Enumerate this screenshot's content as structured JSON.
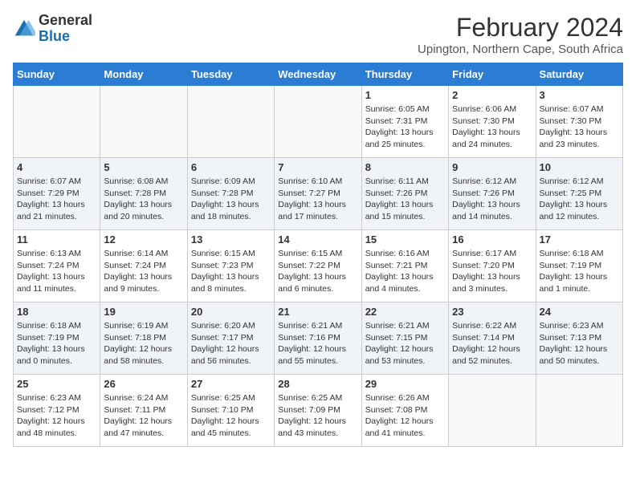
{
  "header": {
    "logo_general": "General",
    "logo_blue": "Blue",
    "month_year": "February 2024",
    "location": "Upington, Northern Cape, South Africa"
  },
  "weekdays": [
    "Sunday",
    "Monday",
    "Tuesday",
    "Wednesday",
    "Thursday",
    "Friday",
    "Saturday"
  ],
  "weeks": [
    [
      {
        "day": "",
        "info": ""
      },
      {
        "day": "",
        "info": ""
      },
      {
        "day": "",
        "info": ""
      },
      {
        "day": "",
        "info": ""
      },
      {
        "day": "1",
        "info": "Sunrise: 6:05 AM\nSunset: 7:31 PM\nDaylight: 13 hours\nand 25 minutes."
      },
      {
        "day": "2",
        "info": "Sunrise: 6:06 AM\nSunset: 7:30 PM\nDaylight: 13 hours\nand 24 minutes."
      },
      {
        "day": "3",
        "info": "Sunrise: 6:07 AM\nSunset: 7:30 PM\nDaylight: 13 hours\nand 23 minutes."
      }
    ],
    [
      {
        "day": "4",
        "info": "Sunrise: 6:07 AM\nSunset: 7:29 PM\nDaylight: 13 hours\nand 21 minutes."
      },
      {
        "day": "5",
        "info": "Sunrise: 6:08 AM\nSunset: 7:28 PM\nDaylight: 13 hours\nand 20 minutes."
      },
      {
        "day": "6",
        "info": "Sunrise: 6:09 AM\nSunset: 7:28 PM\nDaylight: 13 hours\nand 18 minutes."
      },
      {
        "day": "7",
        "info": "Sunrise: 6:10 AM\nSunset: 7:27 PM\nDaylight: 13 hours\nand 17 minutes."
      },
      {
        "day": "8",
        "info": "Sunrise: 6:11 AM\nSunset: 7:26 PM\nDaylight: 13 hours\nand 15 minutes."
      },
      {
        "day": "9",
        "info": "Sunrise: 6:12 AM\nSunset: 7:26 PM\nDaylight: 13 hours\nand 14 minutes."
      },
      {
        "day": "10",
        "info": "Sunrise: 6:12 AM\nSunset: 7:25 PM\nDaylight: 13 hours\nand 12 minutes."
      }
    ],
    [
      {
        "day": "11",
        "info": "Sunrise: 6:13 AM\nSunset: 7:24 PM\nDaylight: 13 hours\nand 11 minutes."
      },
      {
        "day": "12",
        "info": "Sunrise: 6:14 AM\nSunset: 7:24 PM\nDaylight: 13 hours\nand 9 minutes."
      },
      {
        "day": "13",
        "info": "Sunrise: 6:15 AM\nSunset: 7:23 PM\nDaylight: 13 hours\nand 8 minutes."
      },
      {
        "day": "14",
        "info": "Sunrise: 6:15 AM\nSunset: 7:22 PM\nDaylight: 13 hours\nand 6 minutes."
      },
      {
        "day": "15",
        "info": "Sunrise: 6:16 AM\nSunset: 7:21 PM\nDaylight: 13 hours\nand 4 minutes."
      },
      {
        "day": "16",
        "info": "Sunrise: 6:17 AM\nSunset: 7:20 PM\nDaylight: 13 hours\nand 3 minutes."
      },
      {
        "day": "17",
        "info": "Sunrise: 6:18 AM\nSunset: 7:19 PM\nDaylight: 13 hours\nand 1 minute."
      }
    ],
    [
      {
        "day": "18",
        "info": "Sunrise: 6:18 AM\nSunset: 7:19 PM\nDaylight: 13 hours\nand 0 minutes."
      },
      {
        "day": "19",
        "info": "Sunrise: 6:19 AM\nSunset: 7:18 PM\nDaylight: 12 hours\nand 58 minutes."
      },
      {
        "day": "20",
        "info": "Sunrise: 6:20 AM\nSunset: 7:17 PM\nDaylight: 12 hours\nand 56 minutes."
      },
      {
        "day": "21",
        "info": "Sunrise: 6:21 AM\nSunset: 7:16 PM\nDaylight: 12 hours\nand 55 minutes."
      },
      {
        "day": "22",
        "info": "Sunrise: 6:21 AM\nSunset: 7:15 PM\nDaylight: 12 hours\nand 53 minutes."
      },
      {
        "day": "23",
        "info": "Sunrise: 6:22 AM\nSunset: 7:14 PM\nDaylight: 12 hours\nand 52 minutes."
      },
      {
        "day": "24",
        "info": "Sunrise: 6:23 AM\nSunset: 7:13 PM\nDaylight: 12 hours\nand 50 minutes."
      }
    ],
    [
      {
        "day": "25",
        "info": "Sunrise: 6:23 AM\nSunset: 7:12 PM\nDaylight: 12 hours\nand 48 minutes."
      },
      {
        "day": "26",
        "info": "Sunrise: 6:24 AM\nSunset: 7:11 PM\nDaylight: 12 hours\nand 47 minutes."
      },
      {
        "day": "27",
        "info": "Sunrise: 6:25 AM\nSunset: 7:10 PM\nDaylight: 12 hours\nand 45 minutes."
      },
      {
        "day": "28",
        "info": "Sunrise: 6:25 AM\nSunset: 7:09 PM\nDaylight: 12 hours\nand 43 minutes."
      },
      {
        "day": "29",
        "info": "Sunrise: 6:26 AM\nSunset: 7:08 PM\nDaylight: 12 hours\nand 41 minutes."
      },
      {
        "day": "",
        "info": ""
      },
      {
        "day": "",
        "info": ""
      }
    ]
  ]
}
